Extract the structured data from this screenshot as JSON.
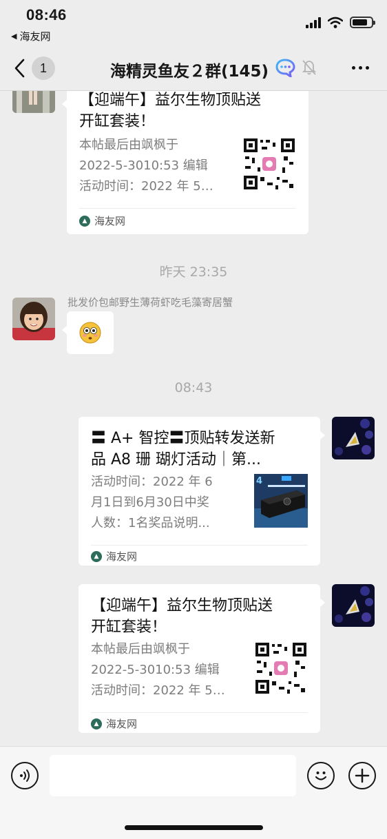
{
  "status_bar": {
    "time": "08:46",
    "back_app": "海友网"
  },
  "nav": {
    "unread_count": "1",
    "title": "海精灵鱼友２群(145)",
    "icons": [
      "chevron-left-icon",
      "chat-bubble-icon",
      "mute-bell-icon",
      "more-icon"
    ]
  },
  "messages": [
    {
      "type": "link_card",
      "side": "left",
      "title": "【迎端午】益尔生物顶贴送开缸套装！",
      "desc": "本帖最后由飒枫于2022-5-3010:53编辑 活动时间：2022年5…",
      "source": "海友网",
      "thumb": "qr-code"
    },
    {
      "type": "timestamp",
      "text": "昨天 23:35"
    },
    {
      "type": "emoji",
      "side": "left",
      "sender": "批发价包邮野生薄荷虾吃毛藻寄居蟹",
      "emoji": "😳"
    },
    {
      "type": "timestamp",
      "text": "08:43"
    },
    {
      "type": "link_card",
      "side": "right",
      "title": "〓A+智控〓顶贴转发送新品A8珊瑚灯活动｜第...",
      "desc": "活动时间：2022年6月1日到6月30日中奖人数：1名奖品说明...",
      "source": "海友网",
      "thumb": "product-image"
    },
    {
      "type": "link_card",
      "side": "right",
      "title": "【迎端午】益尔生物顶贴送开缸套装！",
      "desc": "本帖最后由飒枫于2022-5-3010:53编辑 活动时间：2022年5…",
      "source": "海友网",
      "thumb": "qr-code"
    }
  ],
  "card_lines": {
    "c1_title_1": "【迎端午】益尔生物顶贴送",
    "c1_title_2": "开缸套装！",
    "c1_desc_1": "本帖最后由飒枫于",
    "c1_desc_2": "2022-5-3010:53 编辑",
    "c1_desc_3": "活动时间：2022 年 5…",
    "c2_title_1": "〓 A+ 智控〓顶贴转发送新",
    "c2_title_2": "品 A8 珊 瑚灯活动｜第...",
    "c2_desc_1": "活动时间：2022 年 6",
    "c2_desc_2": "月1日到6月30日中奖",
    "c2_desc_3": "人数：1名奖品说明...",
    "c3_title_1": "【迎端午】益尔生物顶贴送",
    "c3_title_2": "开缸套装！",
    "c3_desc_1": "本帖最后由飒枫于",
    "c3_desc_2": "2022-5-3010:53 编辑",
    "c3_desc_3": "活动时间：2022 年 5…"
  },
  "input_bar": {
    "text": "",
    "icons": [
      "voice-icon",
      "emoji-icon",
      "plus-icon"
    ]
  }
}
